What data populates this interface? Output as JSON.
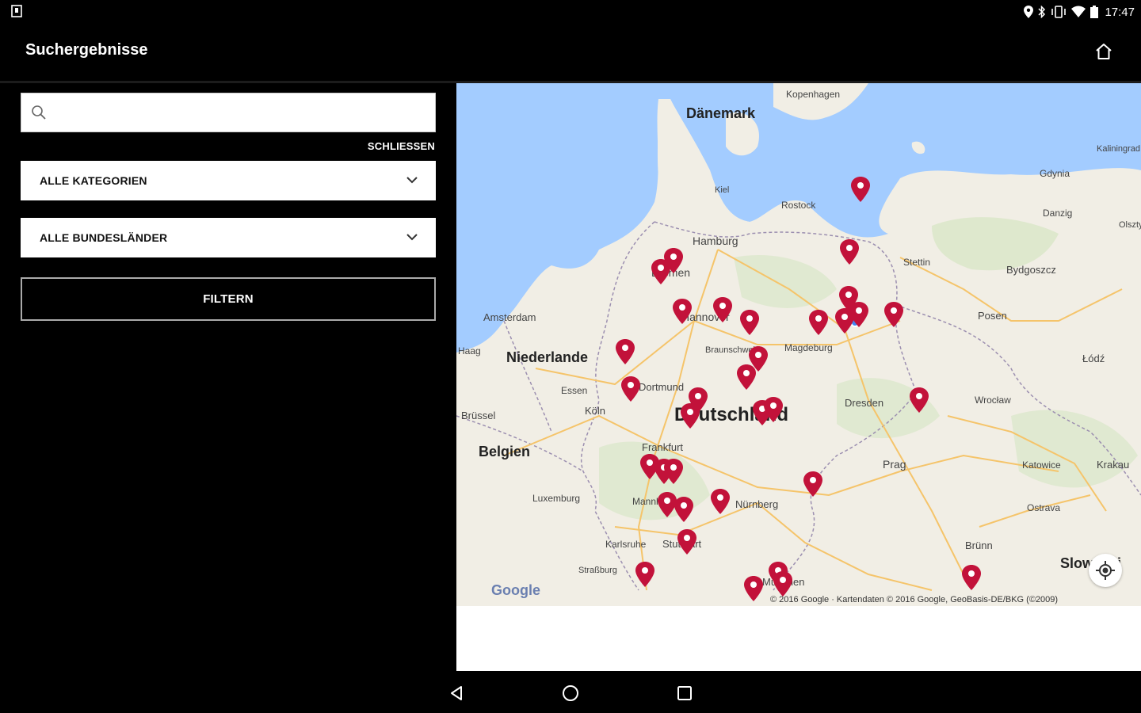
{
  "status_bar": {
    "time": "17:47",
    "left_icon": "sim-card-icon",
    "icons": [
      "location-icon",
      "bluetooth-icon",
      "vibrate-icon",
      "wifi-icon",
      "battery-icon"
    ]
  },
  "app_bar": {
    "title": "Suchergebnisse",
    "home_icon": "home-icon"
  },
  "filters": {
    "search": {
      "value": "",
      "placeholder": ""
    },
    "close_label": "SCHLIESSEN",
    "category_select": "ALLE KATEGORIEN",
    "state_select": "ALLE BUNDESLÄNDER",
    "filter_button": "FILTERN"
  },
  "map": {
    "country_labels": [
      "Dänemark",
      "Niederlande",
      "Belgien",
      "Deutschland",
      "Slowakei"
    ],
    "city_labels": [
      "Kopenhagen",
      "Kiel",
      "Rostock",
      "Hamburg",
      "Bremen",
      "Hannover",
      "Amsterdam",
      "Haag",
      "Braunschweig",
      "Magdeburg",
      "Essen",
      "Dortmund",
      "Köln",
      "Brüssel",
      "Dresden",
      "Frankfurt",
      "Luxemburg",
      "Mannheim",
      "Nürnberg",
      "Karlsruhe",
      "Stuttgart",
      "Straßburg",
      "München",
      "Prag",
      "Stettin",
      "Danzig",
      "Gdynia",
      "Bydgoszcz",
      "Posen",
      "Łódź",
      "Wrocław",
      "Katowice",
      "Krakau",
      "Ostrava",
      "Brünn",
      "Olsztyn",
      "Kaliningrad"
    ],
    "copyright": "© 2016 Google · Kartendaten © 2016 Google, GeoBasis-DE/BKG (©2009)",
    "attribution": "Google",
    "locate_icon": "my-location-icon",
    "marker_color": "#c2123a"
  },
  "nav_bar": {
    "back_icon": "back-triangle-icon",
    "home_icon": "home-circle-icon",
    "recents_icon": "recents-square-icon"
  }
}
